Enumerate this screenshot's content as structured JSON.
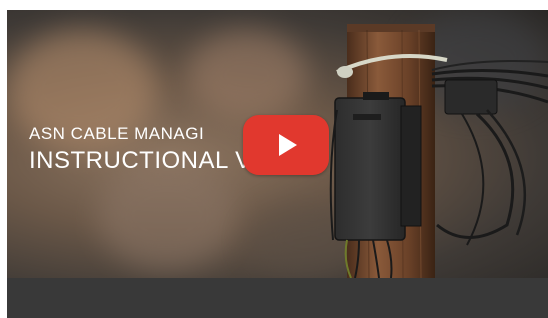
{
  "video": {
    "caption_line1": "ASN CABLE MANAGI",
    "caption_line2": "INSTRUCTIONAL V",
    "play_icon": "play-icon",
    "colors": {
      "play_button": "#e1382e",
      "bottom_bar": "#393939",
      "caption_text": "#ffffff"
    }
  }
}
